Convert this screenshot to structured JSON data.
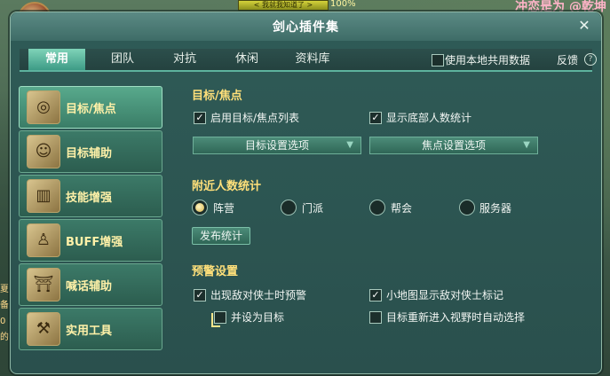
{
  "window": {
    "title": "剑心插件集"
  },
  "tabs": [
    {
      "label": "常用",
      "active": true
    },
    {
      "label": "团队",
      "active": false
    },
    {
      "label": "对抗",
      "active": false
    },
    {
      "label": "休闲",
      "active": false
    },
    {
      "label": "资料库",
      "active": false
    }
  ],
  "options": {
    "share_data_label": "使用本地共用数据",
    "share_data_checked": false,
    "feedback_label": "反馈"
  },
  "sidebar": {
    "items": [
      {
        "label": "目标/焦点",
        "icon": "target-focus-icon",
        "active": true
      },
      {
        "label": "目标辅助",
        "icon": "character-portrait-icon",
        "active": false
      },
      {
        "label": "技能增强",
        "icon": "skill-book-icon",
        "active": false
      },
      {
        "label": "BUFF增强",
        "icon": "buff-character-icon",
        "active": false
      },
      {
        "label": "喊话辅助",
        "icon": "gate-icon",
        "active": false
      },
      {
        "label": "实用工具",
        "icon": "tools-icon",
        "active": false
      }
    ]
  },
  "sections": {
    "target_focus": {
      "title": "目标/焦点",
      "enable_list": {
        "label": "启用目标/焦点列表",
        "checked": true
      },
      "show_bottom_count": {
        "label": "显示底部人数统计",
        "checked": true
      },
      "target_settings_label": "目标设置选项",
      "focus_settings_label": "焦点设置选项"
    },
    "nearby": {
      "title": "附近人数统计",
      "radios": [
        {
          "label": "阵营",
          "selected": true
        },
        {
          "label": "门派",
          "selected": false
        },
        {
          "label": "帮会",
          "selected": false
        },
        {
          "label": "服务器",
          "selected": false
        }
      ],
      "publish_button": "发布统计"
    },
    "warning": {
      "title": "预警设置",
      "hostile_warning": {
        "label": "出现敌对侠士时预警",
        "checked": true
      },
      "minimap_mark": {
        "label": "小地图显示敌对侠士标记",
        "checked": true
      },
      "set_as_target": {
        "label": "并设为目标",
        "checked": false
      },
      "auto_select": {
        "label": "目标重新进入视野时自动选择",
        "checked": false
      }
    }
  },
  "background": {
    "hp_text": "< 我就我知道了 >",
    "hp_pct": "100%",
    "top_right": "冲恋是为 @乾坤",
    "left_edge": "夏 备 0 的"
  },
  "colors": {
    "accent": "#5db39e",
    "section_title": "#ffe07a",
    "sidebar_label": "#fff1a8"
  }
}
